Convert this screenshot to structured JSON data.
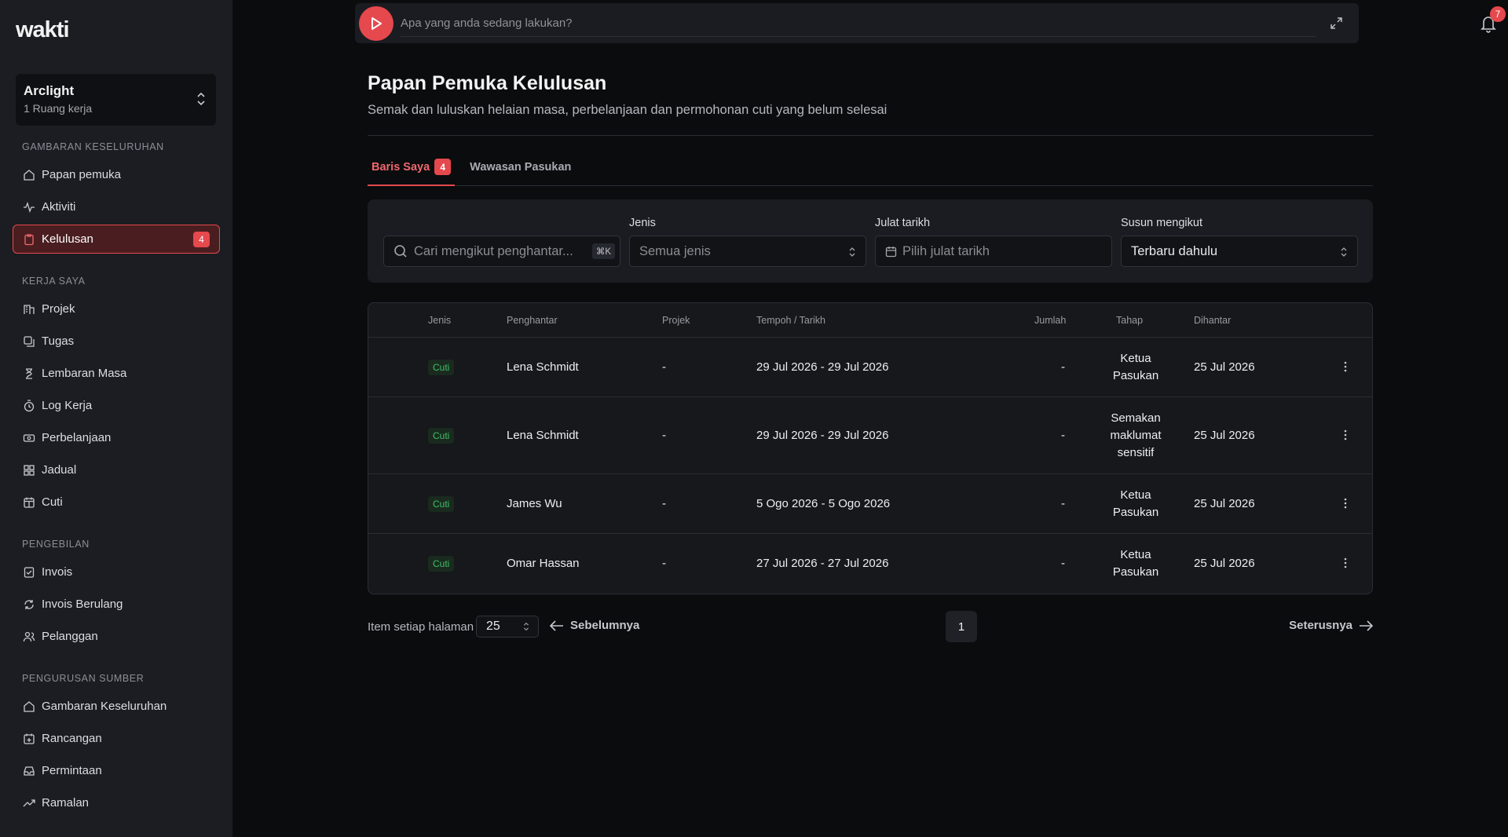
{
  "app": {
    "logo": "wakti"
  },
  "workspace": {
    "name": "Arclight",
    "sub": "1 Ruang kerja"
  },
  "sidebar": {
    "groups": [
      {
        "title": "GAMBARAN KESELURUHAN",
        "items": [
          {
            "label": "Papan pemuka",
            "icon": "home-icon"
          },
          {
            "label": "Aktiviti",
            "icon": "activity-icon"
          },
          {
            "label": "Kelulusan",
            "icon": "clipboard-icon",
            "active": true,
            "badge": "4"
          }
        ]
      },
      {
        "title": "KERJA SAYA",
        "items": [
          {
            "label": "Projek",
            "icon": "building-icon"
          },
          {
            "label": "Tugas",
            "icon": "tasks-icon"
          },
          {
            "label": "Lembaran Masa",
            "icon": "hourglass-icon"
          },
          {
            "label": "Log Kerja",
            "icon": "timer-icon"
          },
          {
            "label": "Perbelanjaan",
            "icon": "money-icon"
          },
          {
            "label": "Jadual",
            "icon": "grid-icon"
          },
          {
            "label": "Cuti",
            "icon": "calendar-icon"
          }
        ]
      },
      {
        "title": "PENGEBILAN",
        "items": [
          {
            "label": "Invois",
            "icon": "invoice-icon"
          },
          {
            "label": "Invois Berulang",
            "icon": "refresh-icon"
          },
          {
            "label": "Pelanggan",
            "icon": "users-icon"
          }
        ]
      },
      {
        "title": "PENGURUSAN SUMBER",
        "items": [
          {
            "label": "Gambaran Keseluruhan",
            "icon": "home-icon"
          },
          {
            "label": "Rancangan",
            "icon": "calendar-plus-icon"
          },
          {
            "label": "Permintaan",
            "icon": "inbox-icon"
          },
          {
            "label": "Ramalan",
            "icon": "trend-icon"
          }
        ]
      }
    ]
  },
  "topbar": {
    "placeholder": "Apa yang anda sedang lakukan?",
    "notifications": "7"
  },
  "page": {
    "title": "Papan Pemuka Kelulusan",
    "subtitle": "Semak dan luluskan helaian masa, perbelanjaan dan permohonan cuti yang belum selesai"
  },
  "tabs": [
    {
      "label": "Baris Saya",
      "badge": "4",
      "active": true
    },
    {
      "label": "Wawasan Pasukan"
    }
  ],
  "filters": {
    "search_placeholder": "Cari mengikut penghantar...",
    "search_kbd": "⌘K",
    "type_label": "Jenis",
    "type_value": "Semua jenis",
    "date_label": "Julat tarikh",
    "date_placeholder": "Pilih julat tarikh",
    "sort_label": "Susun mengikut",
    "sort_value": "Terbaru dahulu"
  },
  "table": {
    "headers": {
      "type": "Jenis",
      "submitter": "Penghantar",
      "project": "Projek",
      "period": "Tempoh / Tarikh",
      "amount": "Jumlah",
      "stage": "Tahap",
      "submitted": "Dihantar"
    },
    "rows": [
      {
        "type": "Cuti",
        "submitter": "Lena Schmidt",
        "project": "-",
        "period": "29 Jul 2026 - 29 Jul 2026",
        "amount": "-",
        "stage": [
          "Ketua",
          "Pasukan"
        ],
        "submitted": "25 Jul 2026"
      },
      {
        "type": "Cuti",
        "submitter": "Lena Schmidt",
        "project": "-",
        "period": "29 Jul 2026 - 29 Jul 2026",
        "amount": "-",
        "stage": [
          "Semakan",
          "maklumat",
          "sensitif"
        ],
        "submitted": "25 Jul 2026"
      },
      {
        "type": "Cuti",
        "submitter": "James Wu",
        "project": "-",
        "period": "5 Ogo 2026 - 5 Ogo 2026",
        "amount": "-",
        "stage": [
          "Ketua",
          "Pasukan"
        ],
        "submitted": "25 Jul 2026"
      },
      {
        "type": "Cuti",
        "submitter": "Omar Hassan",
        "project": "-",
        "period": "27 Jul 2026 - 27 Jul 2026",
        "amount": "-",
        "stage": [
          "Ketua",
          "Pasukan"
        ],
        "submitted": "25 Jul 2026"
      }
    ]
  },
  "pager": {
    "per_page_label": "Item setiap halaman",
    "per_page": "25",
    "prev": "Sebelumnya",
    "page": "1",
    "next": "Seterusnya"
  },
  "colors": {
    "accent": "#e5484d",
    "success": "#3fbf64",
    "sidebar_bg": "#1b1d22",
    "page_bg": "#0b0c0e"
  }
}
